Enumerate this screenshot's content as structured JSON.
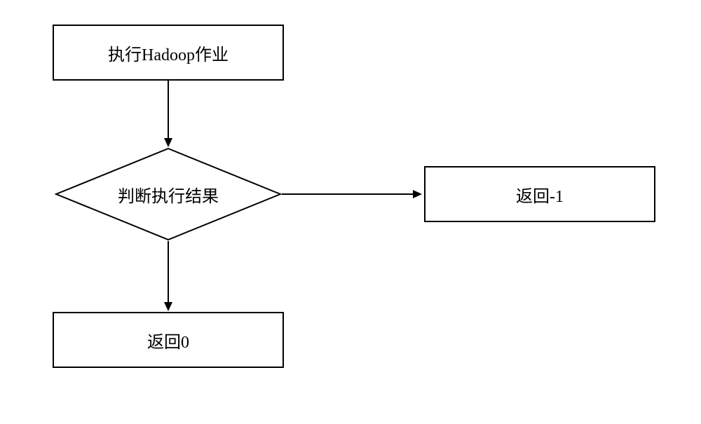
{
  "flowchart": {
    "step1": "执行Hadoop作业",
    "decision": "判断执行结果",
    "result_right": "返回-1",
    "result_down": "返回0"
  }
}
